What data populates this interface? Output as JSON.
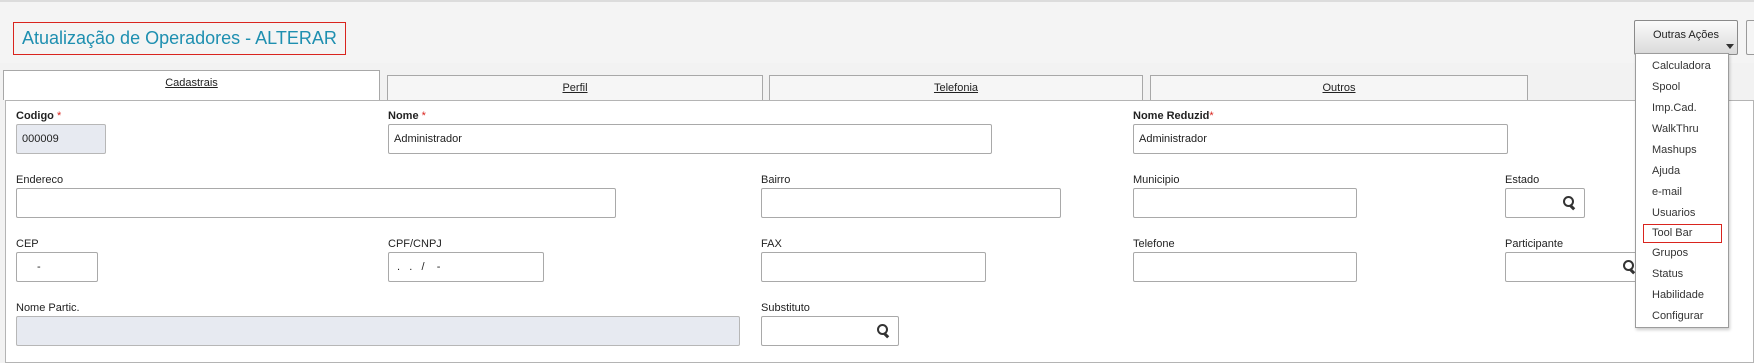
{
  "header": {
    "title": "Atualização de Operadores - ALTERAR",
    "actions_button_label": "Outras Ações"
  },
  "tabs": [
    {
      "label": "Cadastrais",
      "active": true
    },
    {
      "label": "Perfil",
      "active": false
    },
    {
      "label": "Telefonia",
      "active": false
    },
    {
      "label": "Outros",
      "active": false
    }
  ],
  "form": {
    "codigo": {
      "label": "Codigo",
      "required_mark": "*",
      "value": "000009"
    },
    "nome": {
      "label": "Nome",
      "required_mark": "*",
      "value": "Administrador"
    },
    "nome_reduzido": {
      "label": "Nome Reduzid",
      "required_mark": "*",
      "value": "Administrador"
    },
    "endereco": {
      "label": "Endereco",
      "value": ""
    },
    "bairro": {
      "label": "Bairro",
      "value": ""
    },
    "municipio": {
      "label": "Municipio",
      "value": ""
    },
    "estado": {
      "label": "Estado",
      "value": ""
    },
    "cep": {
      "label": "CEP",
      "value": "-"
    },
    "cpf_cnpj": {
      "label": "CPF/CNPJ",
      "value": " .   .   /    -"
    },
    "fax": {
      "label": "FAX",
      "value": ""
    },
    "telefone": {
      "label": "Telefone",
      "value": ""
    },
    "participante": {
      "label": "Participante",
      "value": ""
    },
    "nome_partic": {
      "label": "Nome Partic.",
      "value": ""
    },
    "substituto": {
      "label": "Substituto",
      "value": ""
    }
  },
  "actions_menu": {
    "items": [
      "Calculadora",
      "Spool",
      "Imp.Cad.",
      "WalkThru",
      "Mashups",
      "Ajuda",
      "e-mail",
      "Usuarios",
      "Tool Bar",
      "Grupos",
      "Status",
      "Habilidade",
      "Configurar"
    ],
    "highlighted_index": 8
  },
  "colors": {
    "title": "#1e8fb0",
    "required": "#d9241e",
    "readonly_field": "#e7eaf1",
    "highlight_border": "#d9241e"
  },
  "icons": {
    "lookup": "magnifier-icon",
    "dropdown": "triangle-down-icon"
  }
}
